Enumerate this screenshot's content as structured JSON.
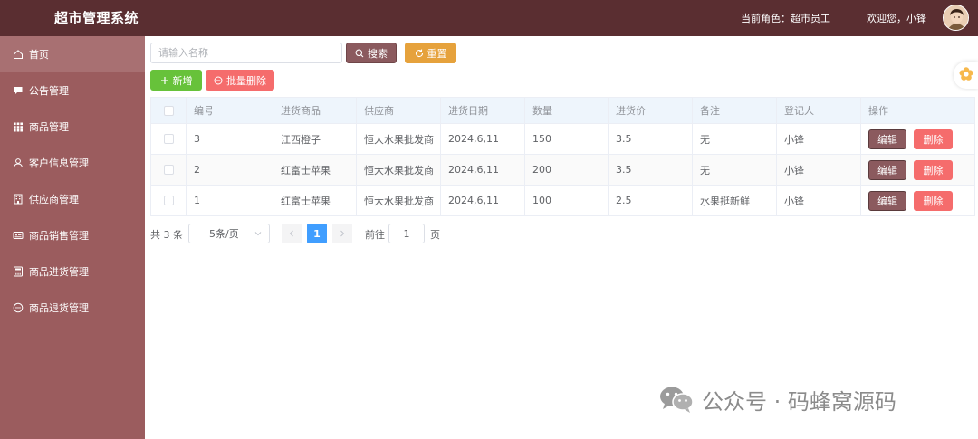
{
  "header": {
    "title": "超市管理系统",
    "role_text": "当前角色：超市员工",
    "welcome_text": "欢迎您，小锋"
  },
  "sidebar": {
    "items": [
      {
        "label": "首页",
        "icon": "home-icon",
        "active": true
      },
      {
        "label": "公告管理",
        "icon": "chat-icon"
      },
      {
        "label": "商品管理",
        "icon": "grid-icon"
      },
      {
        "label": "客户信息管理",
        "icon": "user-icon"
      },
      {
        "label": "供应商管理",
        "icon": "building-icon"
      },
      {
        "label": "商品销售管理",
        "icon": "card-icon"
      },
      {
        "label": "商品进货管理",
        "icon": "calculator-icon"
      },
      {
        "label": "商品退货管理",
        "icon": "message-dots-icon"
      }
    ]
  },
  "toolbar": {
    "search_placeholder": "请输入名称",
    "search_label": "搜索",
    "reset_label": "重置",
    "add_label": "新增",
    "batch_delete_label": "批量删除"
  },
  "table": {
    "columns": [
      "编号",
      "进货商品",
      "供应商",
      "进货日期",
      "数量",
      "进货价",
      "备注",
      "登记人",
      "操作"
    ],
    "rows": [
      {
        "id": "3",
        "product": "江西橙子",
        "supplier": "恒大水果批发商",
        "date": "2024,6,11",
        "qty": "150",
        "price": "3.5",
        "note": "无",
        "registrar": "小锋"
      },
      {
        "id": "2",
        "product": "红富士苹果",
        "supplier": "恒大水果批发商",
        "date": "2024,6,11",
        "qty": "200",
        "price": "3.5",
        "note": "无",
        "registrar": "小锋"
      },
      {
        "id": "1",
        "product": "红富士苹果",
        "supplier": "恒大水果批发商",
        "date": "2024,6,11",
        "qty": "100",
        "price": "2.5",
        "note": "水果挺新鲜",
        "registrar": "小锋"
      }
    ],
    "edit_label": "编辑",
    "delete_label": "删除"
  },
  "pagination": {
    "total_text": "共 3 条",
    "page_size": "5条/页",
    "current_page": "1",
    "goto_label": "前往",
    "goto_value": "1",
    "page_suffix": "页"
  },
  "watermark": {
    "text": "公众号 · 码蜂窝源码"
  },
  "colors": {
    "header_bg": "#5a2e31",
    "sidebar_bg": "#9b5c5e",
    "primary_brown": "#8b5a5e",
    "success": "#67c23a",
    "warning": "#e6a23c",
    "danger": "#f56c6c",
    "page_active": "#409eff"
  }
}
